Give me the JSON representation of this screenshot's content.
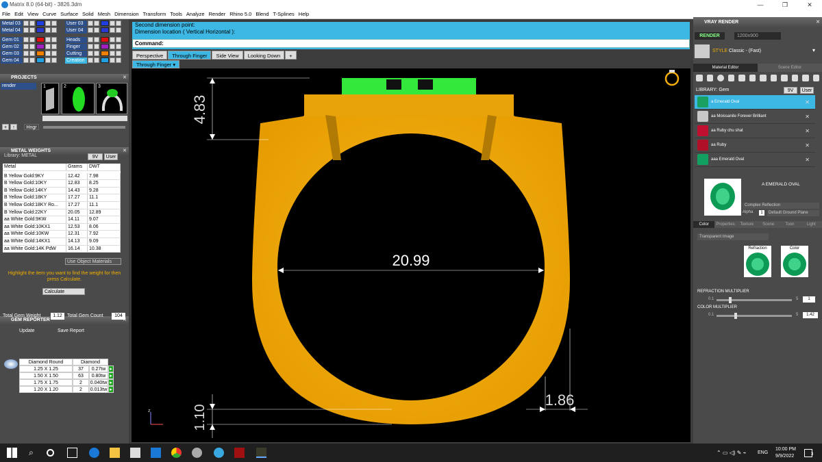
{
  "window": {
    "title": "Matrix 8.0 (64-bit) - 3826.3dm",
    "min": "—",
    "max": "❐",
    "close": "✕"
  },
  "menu": [
    "File",
    "Edit",
    "View",
    "Curve",
    "Surface",
    "Solid",
    "Mesh",
    "Dimension",
    "Transform",
    "Tools",
    "Analyze",
    "Render",
    "Rhino 5.0",
    "Blend",
    "T-Splines",
    "Help"
  ],
  "layers_left": [
    "Metal 03",
    "Metal 04",
    "Gem 01",
    "Gem 02",
    "Gem 03",
    "Gem 04"
  ],
  "layers_right": [
    "User 03",
    "User 04",
    "Heads",
    "Finger",
    "Cutting",
    "Creation"
  ],
  "layer_colors": [
    "#1f3fe0",
    "#2a3ad0",
    "#e01010",
    "#a020c0",
    "#f08000",
    "#20a0e0"
  ],
  "projects": {
    "title": "PROJECTS",
    "item": "render",
    "thumbs": [
      "1",
      "2",
      "3"
    ],
    "hinge_label": "Hngr"
  },
  "metal_weights": {
    "title": "METAL WEIGHTS",
    "library_label": "Library: METAL",
    "library_opts": [
      "9V",
      "User"
    ],
    "headers": [
      "Metal",
      "Grams",
      "DWT"
    ],
    "rows": [
      [
        "B Yellow Gold:9KY",
        "12.42",
        "7.98"
      ],
      [
        "B Yellow Gold:10KY",
        "12.83",
        "8.25"
      ],
      [
        "B Yellow Gold:14KY",
        "14.43",
        "9.28"
      ],
      [
        "B Yellow Gold:18KY",
        "17.27",
        "11.1"
      ],
      [
        "B Yellow Gold:18KY Ro...",
        "17.27",
        "11.1"
      ],
      [
        "B Yellow Gold:22KY",
        "20.05",
        "12.89"
      ],
      [
        "aa White Gold:9KW",
        "14.11",
        "9.07"
      ],
      [
        "aa White Gold:10KX1",
        "12.53",
        "8.06"
      ],
      [
        "aa White Gold:10KW",
        "12.31",
        "7.92"
      ],
      [
        "aa White Gold:14KX1",
        "14.13",
        "9.09"
      ],
      [
        "aa White Gold:14K PdW",
        "16.14",
        "10.38"
      ]
    ],
    "use_object": "Use Object Materials",
    "hint": "Highlight the item you want to find the weight for then press Calculate.",
    "calculate": "Calculate"
  },
  "gem_reporter": {
    "title": "GEM REPORTER",
    "total_weight_label": "Total Gem Weight",
    "total_weight": "1.12",
    "total_count_label": "Total Gem Count",
    "total_count": "104",
    "update": "Update",
    "save": "Save Report",
    "headers": [
      "Diamond Round",
      "Diamond"
    ],
    "rows": [
      [
        "1.25 X 1.25",
        "37",
        "0.27tw"
      ],
      [
        "1.50 X 1.50",
        "63",
        "0.80tw"
      ],
      [
        "1.75 X 1.75",
        "2",
        "0.040tw"
      ],
      [
        "1.20 X 1.20",
        "2",
        "0.013tw"
      ]
    ]
  },
  "command": {
    "line1": "Second dimension point:",
    "line2": "Dimension location ( Vertical  Horizontal ):",
    "prompt": "Command:"
  },
  "viewport_tabs": [
    "Perspective",
    "Through Finger",
    "Side View",
    "Looking Down",
    "+"
  ],
  "active_view": "Through Finger",
  "dimensions": {
    "top": "4.83",
    "width": "20.99",
    "side": "1.86",
    "bottom": "1.10"
  },
  "axis_label": "z",
  "vray": {
    "title": "VRAY RENDER",
    "render_btn": "RENDER",
    "resolution": "1200x900",
    "style_label": "STYLE",
    "style_value": "Classic - (Fast)",
    "tabs": [
      "Material Editor",
      "Scene Editor"
    ],
    "library_label": "LIBRARY: Gem",
    "library_opts": [
      "9V",
      "User"
    ],
    "materials": [
      "a Emerald Oval",
      "aa Moissanite Forever Brilliant",
      "aa Ruby chu shat",
      "aa Ruby",
      "aaa Emerald Oval"
    ],
    "material_colors": [
      "#1aa060",
      "#c8c8c8",
      "#c01030",
      "#b01028",
      "#12a060"
    ],
    "selected_name": "A EMERALD OVAL",
    "reflection": "Complex Reflection",
    "alpha_label": "Alpha",
    "alpha_value": "1",
    "ground": "Default Ground Plane",
    "sub_tabs": [
      "Color",
      "Properties",
      "Texture",
      "Scene",
      "Toon",
      "Light"
    ],
    "transparent": "Transparent Image",
    "refraction_label": "Refraction",
    "color_label": "Color",
    "refraction_mult_label": "REFRACTION MULTIPLIER",
    "refraction_min": "0.1",
    "refraction_max": "5",
    "refraction_value": "1",
    "color_mult_label": "COLOR MULTIPLIER",
    "color_min": "0.1",
    "color_max": "5",
    "color_value": "1.42"
  },
  "taskbar": {
    "lang": "ENG",
    "time": "10:00 PM",
    "date": "9/9/2022",
    "notif": "3"
  },
  "colors": {
    "gold": "#f2ad0d",
    "gem": "#33e83a",
    "accent": "#3db7e4"
  }
}
